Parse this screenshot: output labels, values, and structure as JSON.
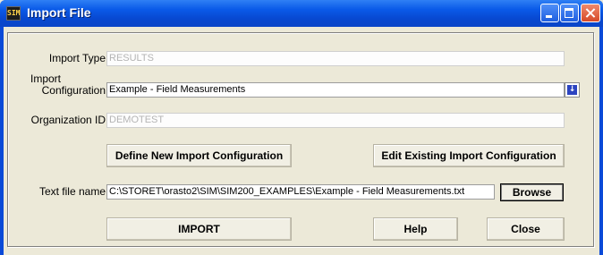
{
  "window": {
    "title": "Import File",
    "icon_glyph": "SIM",
    "controls": [
      "minimize-icon",
      "maximize-icon",
      "close-icon"
    ]
  },
  "form": {
    "import_type": {
      "label": "Import Type",
      "value": "RESULTS"
    },
    "import_config": {
      "label_line1": "Import",
      "label_line2": "Configuration",
      "value": "Example - Field Measurements",
      "dropdown_icon": "down-arrow-icon"
    },
    "org_id": {
      "label": "Organization ID",
      "value": "DEMOTEST"
    },
    "text_file": {
      "label": "Text file name",
      "value": "C:\\STORET\\orasto2\\SIM\\SIM200_EXAMPLES\\Example - Field Measurements.txt"
    }
  },
  "buttons": {
    "define_new": "Define New Import Configuration",
    "edit_existing": "Edit Existing Import Configuration",
    "browse": "Browse",
    "import": "IMPORT",
    "help": "Help",
    "close": "Close"
  },
  "colors": {
    "titlebar": "#0a5ae8",
    "dialog_bg": "#ece9d8",
    "dropdown_accent": "#2c44c0"
  }
}
